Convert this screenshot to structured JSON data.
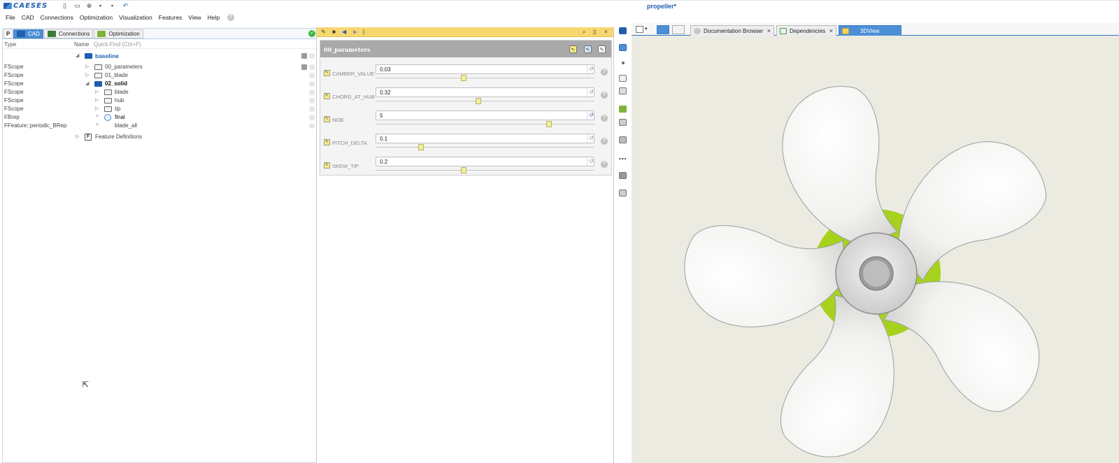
{
  "app": {
    "logo_text": "CAESES",
    "window_title": "propeller*"
  },
  "menu": [
    "File",
    "CAD",
    "Connections",
    "Optimization",
    "Visualization",
    "Features",
    "View",
    "Help"
  ],
  "left_panel": {
    "p_tab": "P",
    "tabs": [
      {
        "label": "CAD",
        "icon": "folder-icon",
        "active": true
      },
      {
        "label": "Connections",
        "icon": "monitor-icon",
        "active": false
      },
      {
        "label": "Optimization",
        "icon": "play-icon",
        "active": false
      }
    ],
    "header": {
      "type": "Type",
      "name": "Name",
      "quick_find": "Quick Find (Ctrl+F)"
    },
    "tree": [
      {
        "type": "",
        "name": "baseline",
        "icon": "folder-filled-icon",
        "expander": "◢",
        "bold": true
      },
      {
        "type": "FScope",
        "name": "00_parameters",
        "icon": "folder-icon",
        "expander": "▷"
      },
      {
        "type": "FScope",
        "name": "01_blade",
        "icon": "folder-icon",
        "expander": "▷"
      },
      {
        "type": "FScope",
        "name": "02_solid",
        "icon": "folder-filled-icon",
        "expander": "◢"
      },
      {
        "type": "FScope",
        "name": "blade",
        "icon": "folder-icon",
        "expander": "▷"
      },
      {
        "type": "FScope",
        "name": "hub",
        "icon": "folder-icon",
        "expander": "▷"
      },
      {
        "type": "FScope",
        "name": "tip",
        "icon": "folder-icon",
        "expander": "▷"
      },
      {
        "type": "FBrep",
        "name": "final",
        "icon": "brep-icon",
        "expander": "+"
      },
      {
        "type": "FFeature::periodic_BRep",
        "name": "blade_all",
        "icon": "",
        "expander": "+"
      },
      {
        "type": "",
        "name": "Feature Definitions",
        "icon": "feature-icon",
        "expander": "▷"
      }
    ]
  },
  "parameters": {
    "group_title": "00_parameters",
    "rows": [
      {
        "name": "CAMBER_VALUE",
        "value": "0.03",
        "slider": 0.4,
        "reset_active": false
      },
      {
        "name": "CHORD_AT_HUB",
        "value": "0.32",
        "slider": 0.47,
        "reset_active": false
      },
      {
        "name": "NOB",
        "value": "5",
        "slider": 0.8,
        "reset_active": true
      },
      {
        "name": "PITCH_DELTA",
        "value": "0.1",
        "slider": 0.2,
        "reset_active": false
      },
      {
        "name": "SKEW_TIP",
        "value": "0.2",
        "slider": 0.4,
        "reset_active": false
      }
    ]
  },
  "right_tabs": [
    {
      "label": "Documentation Browser",
      "icon": "help-icon",
      "active": false
    },
    {
      "label": "Dependencies",
      "icon": "graph-icon",
      "active": false
    },
    {
      "label": "3DView",
      "icon": "cube-icon",
      "active": true
    }
  ],
  "colors": {
    "accent": "#4c8fd6",
    "highlight_green": "#a6d21e",
    "toolbar_yellow": "#f7d770",
    "viewport_bg": "#ecebe2"
  }
}
